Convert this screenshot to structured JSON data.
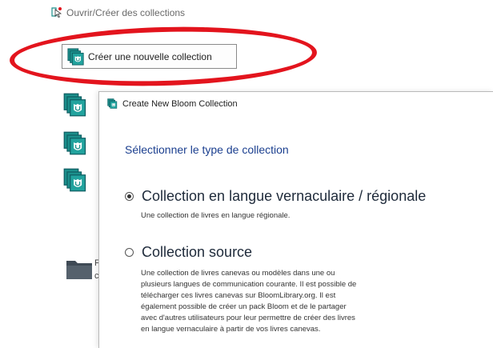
{
  "back_window": {
    "title": "Ouvrir/Créer des collections",
    "create_button_label": "Créer une nouvelle collection",
    "peek_letters": [
      "F",
      "c"
    ]
  },
  "dialog": {
    "title": "Create New Bloom Collection",
    "heading": "Sélectionner le type de collection",
    "options": [
      {
        "label": "Collection en langue vernaculaire / régionale",
        "selected": true,
        "description": [
          "Une collection de livres en langue régionale."
        ]
      },
      {
        "label": "Collection source",
        "selected": false,
        "description": [
          "Une collection de livres canevas ou modèles dans une ou",
          "plusieurs langues de communication courante. Il est possible de",
          "télécharger ces livres canevas sur BloomLibrary.org. Il est",
          "également possible de créer un pack Bloom et de le partager",
          "avec d'autres utilisateurs pour leur permettre de créer des livres",
          "en langue vernaculaire à partir de vos livres canevas."
        ]
      }
    ]
  },
  "icons": {
    "bloom": "bloom-collection-icon",
    "folder": "folder-icon",
    "app": "bloom-app-icon"
  },
  "colors": {
    "annotation": "#e3141d",
    "bloom_teal": "#1b8f8b",
    "bloom_dark": "#0f5f63",
    "heading_blue": "#1b3f8f",
    "folder_dark": "#3f4a55"
  }
}
